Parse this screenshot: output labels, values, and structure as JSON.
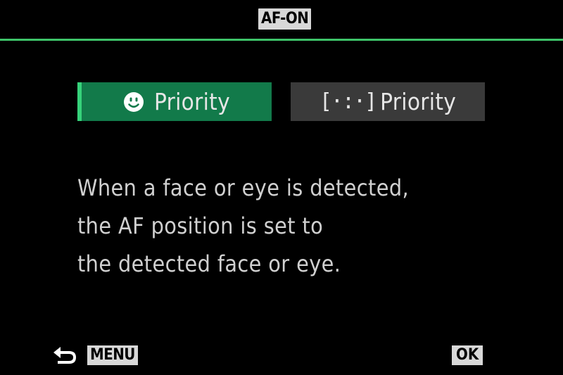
{
  "header": {
    "title": "AF-ON"
  },
  "options": {
    "face_priority": {
      "icon": "face-icon",
      "label": "Priority",
      "selected": true
    },
    "area_priority": {
      "icon": "af-area-icon",
      "icon_glyph": "[·:·]",
      "label": "Priority",
      "selected": false
    }
  },
  "description": {
    "lines": [
      "When a face or eye is detected,",
      "the AF position is set to",
      "the detected face or eye."
    ]
  },
  "footer": {
    "back_icon": "return-arrow-icon",
    "menu_label": "MENU",
    "ok_label": "OK"
  },
  "colors": {
    "accent": "#3ec46a",
    "selected_bg": "#127a4a",
    "unselected_bg": "#3a3a3a",
    "badge_bg": "#d8d8d8"
  }
}
